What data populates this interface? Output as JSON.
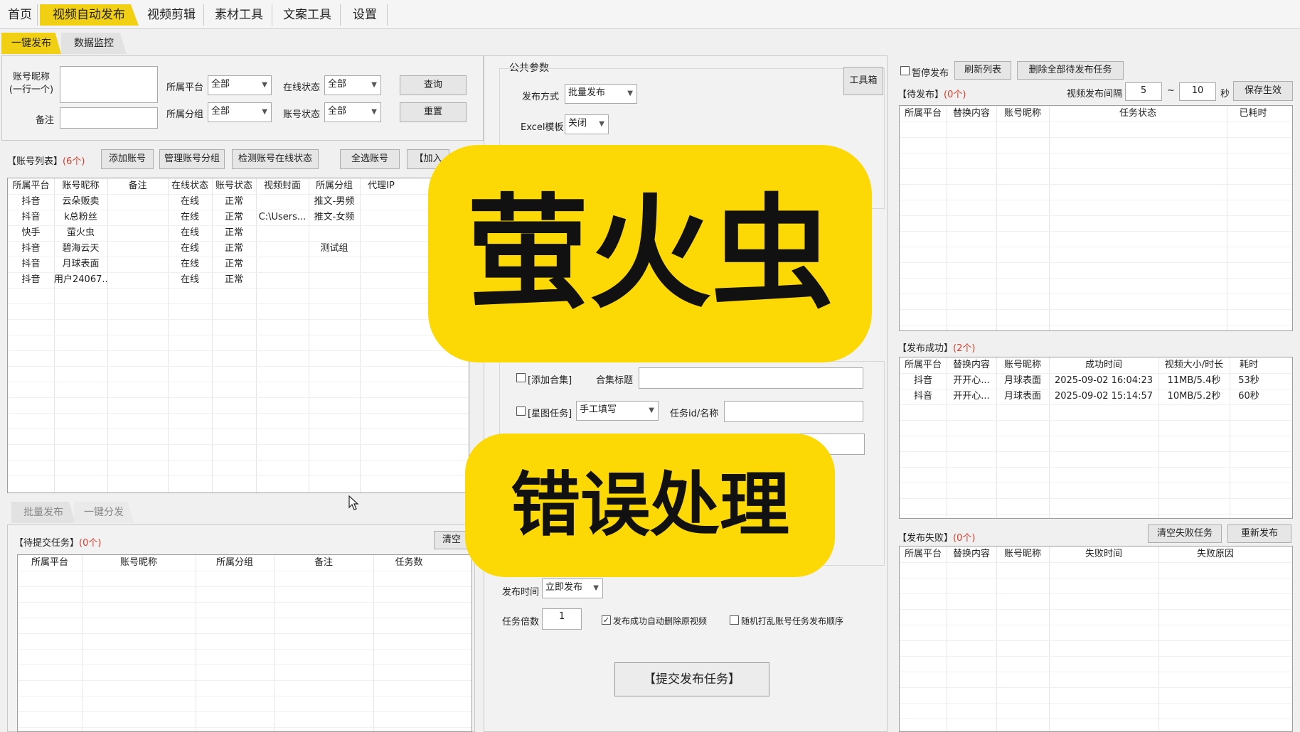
{
  "nav": {
    "tabs": [
      "首页",
      "视频自动发布",
      "视频剪辑",
      "素材工具",
      "文案工具",
      "设置"
    ],
    "subtabs": [
      "一键发布",
      "数据监控"
    ]
  },
  "filter": {
    "nickname_label": "账号昵称\n(一行一个)",
    "remark_label": "备注",
    "platform_label": "所属平台",
    "platform_value": "全部",
    "online_label": "在线状态",
    "online_value": "全部",
    "group_label": "所属分组",
    "group_value": "全部",
    "account_status_label": "账号状态",
    "account_status_value": "全部",
    "query_button": "查询",
    "reset_button": "重置"
  },
  "account_list": {
    "title": "【账号列表】",
    "count": "(6个)",
    "buttons": [
      "添加账号",
      "管理账号分组",
      "检测账号在线状态",
      "全选账号",
      "【加入"
    ],
    "columns": [
      "所属平台",
      "账号昵称",
      "备注",
      "在线状态",
      "账号状态",
      "视频封面",
      "所属分组",
      "代理IP"
    ],
    "rows": [
      [
        "抖音",
        "云朵贩卖",
        "",
        "在线",
        "正常",
        "",
        "推文-男频",
        ""
      ],
      [
        "抖音",
        "k总粉丝",
        "",
        "在线",
        "正常",
        "C:\\Users...",
        "推文-女频",
        ""
      ],
      [
        "快手",
        "萤火虫",
        "",
        "在线",
        "正常",
        "",
        "",
        ""
      ],
      [
        "抖音",
        "碧海云天",
        "",
        "在线",
        "正常",
        "",
        "测试组",
        ""
      ],
      [
        "抖音",
        "月球表面",
        "",
        "在线",
        "正常",
        "",
        "",
        ""
      ],
      [
        "抖音",
        "用户24067...",
        "",
        "在线",
        "正常",
        "",
        "",
        ""
      ]
    ]
  },
  "bottom_tabs": [
    "批量发布",
    "一键分发"
  ],
  "pending_submit": {
    "title": "【待提交任务】",
    "count": "(0个)",
    "clear_button": "清空",
    "columns": [
      "所属平台",
      "账号昵称",
      "所属分组",
      "备注",
      "任务数"
    ]
  },
  "params": {
    "group_title": "公共参数",
    "toolbox_button": "工具箱",
    "publish_mode_label": "发布方式",
    "publish_mode_value": "批量发布",
    "excel_label": "Excel模板",
    "excel_value": "关闭",
    "collection_check_label": "[添加合集]",
    "collection_title_label": "合集标题",
    "star_check_label": "[星图任务]",
    "star_mode_value": "手工填写",
    "task_id_label": "任务id/名称",
    "publish_time_label": "发布时间",
    "publish_time_value": "立即发布",
    "task_multiple_label": "任务倍数",
    "task_multiple_value": "1",
    "auto_delete_label": "发布成功自动删除原视频",
    "random_order_label": "随机打乱账号任务发布顺序",
    "submit_button": "【提交发布任务】"
  },
  "right": {
    "pause_label": "暂停发布",
    "refresh_button": "刷新列表",
    "delete_all_button": "删除全部待发布任务",
    "pending_title": "【待发布】",
    "pending_count": "(0个)",
    "interval_label": "视频发布间隔",
    "interval_min": "5",
    "interval_sep": "~",
    "interval_max": "10",
    "interval_unit": "秒",
    "save_button": "保存生效",
    "pending_columns": [
      "所属平台",
      "替换内容",
      "账号昵称",
      "任务状态",
      "已耗时"
    ],
    "success_title": "【发布成功】",
    "success_count": "(2个)",
    "success_columns": [
      "所属平台",
      "替换内容",
      "账号昵称",
      "成功时间",
      "视频大小/时长",
      "耗时"
    ],
    "success_rows": [
      [
        "抖音",
        "开开心...",
        "月球表面",
        "2025-09-02 16:04:23",
        "11MB/5.4秒",
        "53秒"
      ],
      [
        "抖音",
        "开开心...",
        "月球表面",
        "2025-09-02 15:14:57",
        "10MB/5.2秒",
        "60秒"
      ]
    ],
    "failed_title": "【发布失败】",
    "failed_count": "(0个)",
    "clear_failed_button": "清空失败任务",
    "republish_button": "重新发布",
    "failed_columns": [
      "所属平台",
      "替换内容",
      "账号昵称",
      "失败时间",
      "失败原因"
    ]
  },
  "overlay": {
    "title": "萤火虫",
    "subtitle": "错误处理"
  },
  "colors": {
    "accent": "#f1cf12",
    "overlay": "#fcd904",
    "count_red": "#d43c2b"
  }
}
